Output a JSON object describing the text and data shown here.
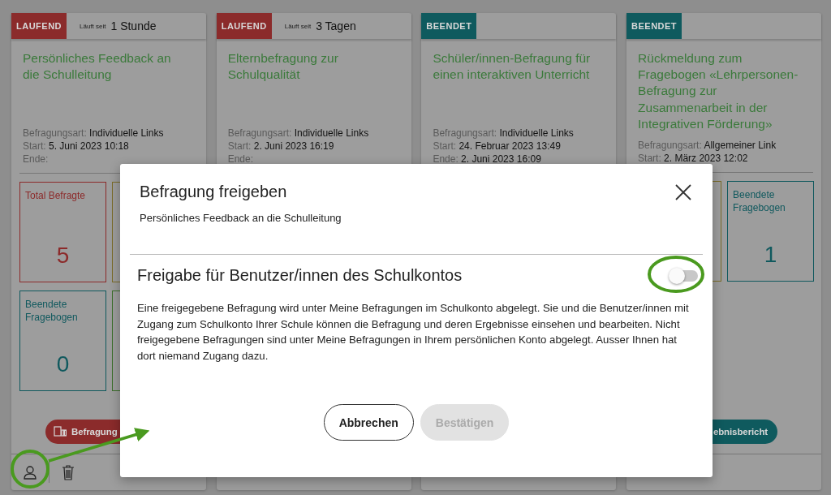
{
  "cards": [
    {
      "status": {
        "label": "LAUFEND",
        "kind": "running"
      },
      "running_since": {
        "prefix": "Läuft seit",
        "value": "1 Stunde"
      },
      "title": "Persönliches Feedback an die Schulleitung",
      "meta": [
        "Befragungsart: **Individuelle Links**",
        "Start: **5. Juni 2023 10:18**",
        "Ende:"
      ],
      "stats": [
        {
          "label": "Total Befragte",
          "value": "5",
          "color": "#8c2a2a"
        },
        {
          "color": "#7a6b27"
        },
        {
          "label": "Beendete Fragebogen",
          "value": "0",
          "color": "#10595e"
        },
        {
          "color": "#3b6e2b"
        }
      ],
      "action": {
        "label": "Befragung"
      },
      "footer": {
        "kind": "owner-actions"
      }
    },
    {
      "status": {
        "label": "LAUFEND",
        "kind": "running"
      },
      "running_since": {
        "prefix": "Läuft seit",
        "value": "3 Tagen"
      },
      "title": "Elternbefragung zur Schulqualität",
      "meta": [
        "Befragungsart: **Individuelle Links**",
        "Start: **2. Juni 2023 16:19**",
        "Ende:"
      ]
    },
    {
      "status": {
        "label": "BEENDET",
        "kind": "finished"
      },
      "title": "Schüler/innen-Befragung für einen interaktiven Unterricht",
      "meta": [
        "Befragungsart: **Individuelle Links**",
        "Start: **24. Februar 2023 13:49**",
        "Ende: **2. Juni 2023 16:09**"
      ]
    },
    {
      "status": {
        "label": "BEENDET",
        "kind": "finished"
      },
      "title": "Rückmeldung zum Fragebogen «Lehrpersonen-Befragung zur Zusammenarbeit in der Integrativen Förderung»",
      "meta": [
        "Befragungsart: **Allgemeiner Link**",
        "Start: **2. März 2023 12:02**"
      ],
      "stats": [
        {
          "color": "#7a6b27"
        },
        {
          "label": "Beendete Fragebogen",
          "value": "1",
          "color": "#10595e"
        }
      ],
      "action": {
        "label": "ebnisbericht"
      }
    }
  ],
  "modal": {
    "title": "Befragung freigeben",
    "subtitle": "Persönliches Feedback an die Schulleitung",
    "section_title": "Freigabe für Benutzer/innen des Schulkontos",
    "share_toggle": {
      "on": false
    },
    "description": "Eine freigegebene Befragung wird unter Meine Befragungen im Schulkonto abgelegt. Sie und die Benutzer/innen mit Zugang zum Schulkonto Ihrer Schule können die Befragung und deren Ergebnisse einsehen und bearbeiten. Nicht freigegebene Befragungen sind unter Meine Befragungen in Ihrem persönlichen Konto abgelegt. Ausser Ihnen hat dort niemand Zugang dazu.",
    "buttons": [
      {
        "label": "Abbrechen",
        "disabled": false
      },
      {
        "label": "Bestätigen",
        "disabled": true
      }
    ]
  },
  "annotations": [
    {
      "kind": "ring"
    },
    {
      "kind": "ring"
    },
    {
      "kind": "arrow"
    }
  ]
}
